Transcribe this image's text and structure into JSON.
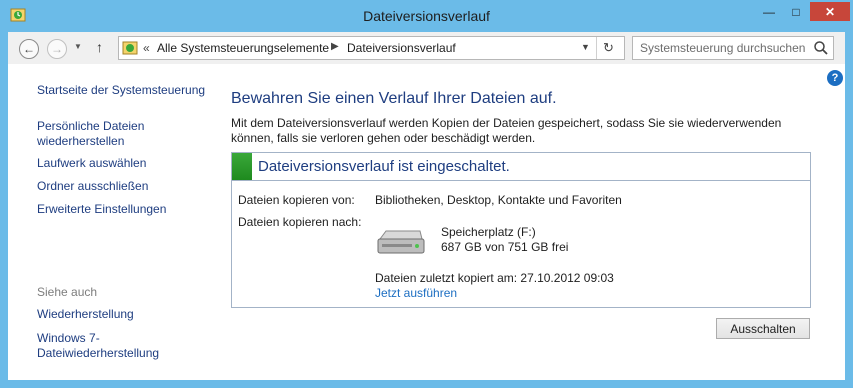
{
  "window": {
    "title": "Dateiversionsverlauf",
    "minimize_glyph": "—",
    "maximize_glyph": "□",
    "close_glyph": "✕"
  },
  "nav": {
    "back_glyph": "←",
    "forward_glyph": "→",
    "recent_glyph": "▼",
    "up_glyph": "↑",
    "chevrons": "«",
    "separator": "▶",
    "breadcrumbs": [
      "Alle Systemsteuerungselemente",
      "Dateiversionsverlauf"
    ],
    "dropdown_glyph": "▼",
    "refresh_glyph": "↻"
  },
  "search": {
    "placeholder": "Systemsteuerung durchsuchen"
  },
  "help": {
    "glyph": "?"
  },
  "sidebar": {
    "home": "Startseite der Systemsteuerung",
    "links": [
      "Persönliche Dateien wiederherstellen",
      "Laufwerk auswählen",
      "Ordner ausschließen",
      "Erweiterte Einstellungen"
    ],
    "see_also_title": "Siehe auch",
    "see_also": [
      "Wiederherstellung",
      "Windows 7-Dateiwiederherstellung"
    ]
  },
  "main": {
    "heading": "Bewahren Sie einen Verlauf Ihrer Dateien auf.",
    "description": "Mit dem Dateiversionsverlauf werden Kopien der Dateien gespeichert, sodass Sie sie wiederverwenden können, falls sie verloren gehen oder beschädigt werden.",
    "status_title": "Dateiversionsverlauf ist eingeschaltet.",
    "copy_from_label": "Dateien kopieren von:",
    "copy_from_value": "Bibliotheken, Desktop, Kontakte und Favoriten",
    "copy_to_label": "Dateien kopieren nach:",
    "drive_name": "Speicherplatz (F:)",
    "drive_free": "687 GB von 751 GB frei",
    "last_copied": "Dateien zuletzt kopiert am: 27.10.2012 09:03",
    "run_now": "Jetzt ausführen",
    "off_button": "Ausschalten"
  },
  "colors": {
    "frame": "#6bbbe8",
    "link": "#1e3d80",
    "action_link": "#1c6ec2",
    "status_green": "#2a9a2a",
    "close_red": "#c7463a"
  }
}
